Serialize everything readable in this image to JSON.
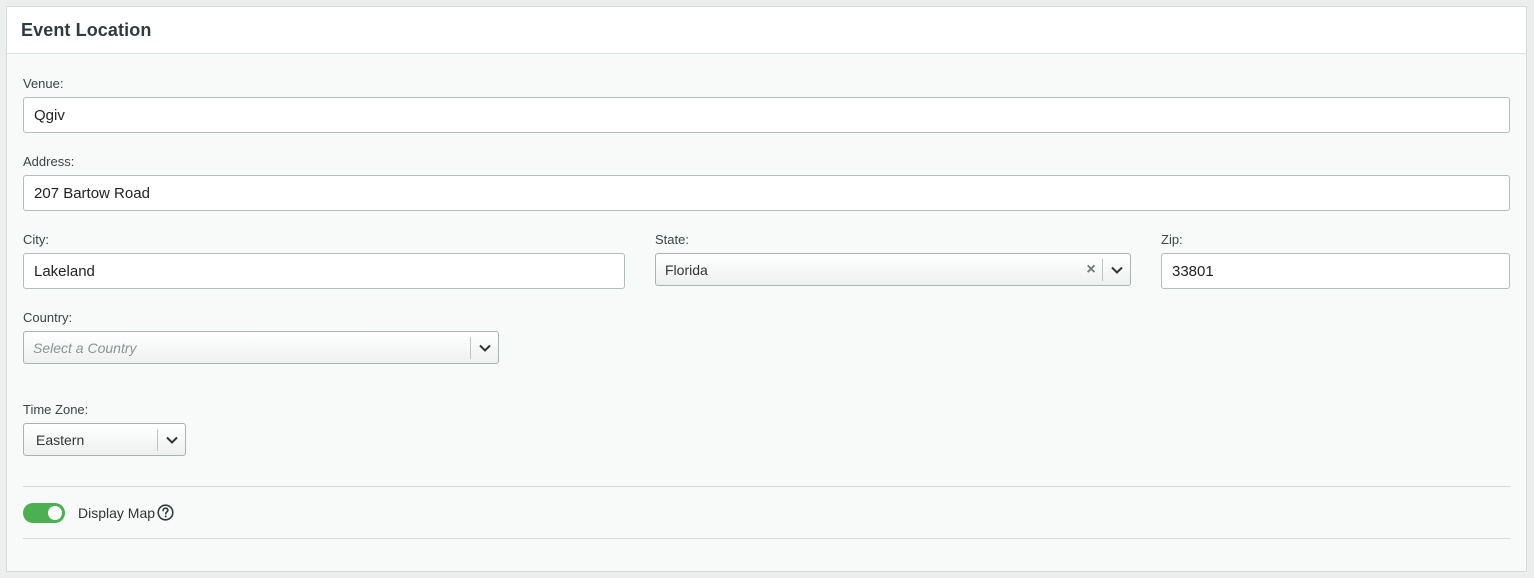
{
  "panel": {
    "title": "Event Location"
  },
  "venue": {
    "label": "Venue:",
    "value": "Qgiv"
  },
  "address": {
    "label": "Address:",
    "value": "207 Bartow Road"
  },
  "city": {
    "label": "City:",
    "value": "Lakeland"
  },
  "state": {
    "label": "State:",
    "value": "Florida",
    "clear_icon": "close-icon",
    "arrow_icon": "chevron-down-icon"
  },
  "zip": {
    "label": "Zip:",
    "value": "33801"
  },
  "country": {
    "label": "Country:",
    "placeholder": "Select a Country",
    "arrow_icon": "chevron-down-icon"
  },
  "timezone": {
    "label": "Time Zone:",
    "value": "Eastern",
    "arrow_icon": "chevron-down-icon"
  },
  "display_map": {
    "label": "Display Map",
    "enabled": true,
    "toggle_color": "#4caf50",
    "help_icon": "question-circle-icon"
  }
}
